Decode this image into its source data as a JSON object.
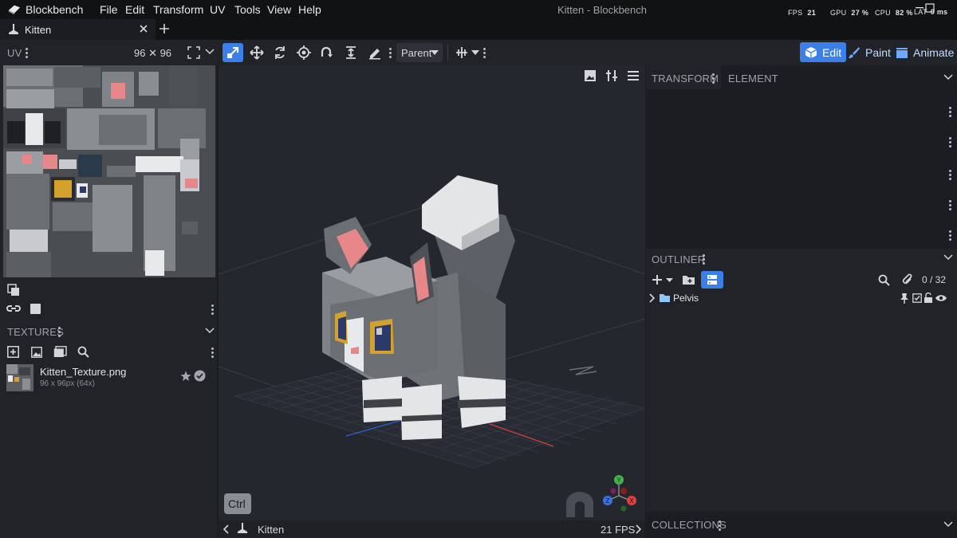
{
  "app": {
    "name": "Blockbench",
    "window_title": "Kitten - Blockbench"
  },
  "menu": [
    "File",
    "Edit",
    "Transform",
    "UV",
    "Tools",
    "View",
    "Help"
  ],
  "stats": {
    "fps_label": "FPS",
    "fps_value": "21",
    "gpu_label": "GPU",
    "gpu_value": "27 %",
    "cpu_label": "CPU",
    "cpu_value": "82 %",
    "lat_label": "LAT",
    "lat_value": "0 ms"
  },
  "tabs": [
    {
      "label": "Kitten"
    }
  ],
  "toolbar": {
    "parent_select": "Parent"
  },
  "modes": {
    "edit": "Edit",
    "paint": "Paint",
    "animate": "Animate"
  },
  "uv_panel": {
    "title": "UV",
    "size": "96 ✕ 96"
  },
  "textures_panel": {
    "title": "TEXTURES",
    "items": [
      {
        "name": "Kitten_Texture.png",
        "info": "96 x 96px (64x)"
      }
    ]
  },
  "viewport": {
    "ctrl_label": "Ctrl"
  },
  "statusbar": {
    "model": "Kitten",
    "fps": "21 FPS"
  },
  "transform_panel": {
    "tab_transform": "TRANSFORM",
    "tab_element": "ELEMENT"
  },
  "outliner": {
    "title": "OUTLINER",
    "count": "0 / 32",
    "items": [
      {
        "label": "Pelvis"
      }
    ]
  },
  "collections": {
    "title": "COLLECTIONS"
  },
  "colors": {
    "accent": "#3a80e8",
    "background": "#1b1d22",
    "panel": "#212328",
    "viewport": "#24272d"
  }
}
